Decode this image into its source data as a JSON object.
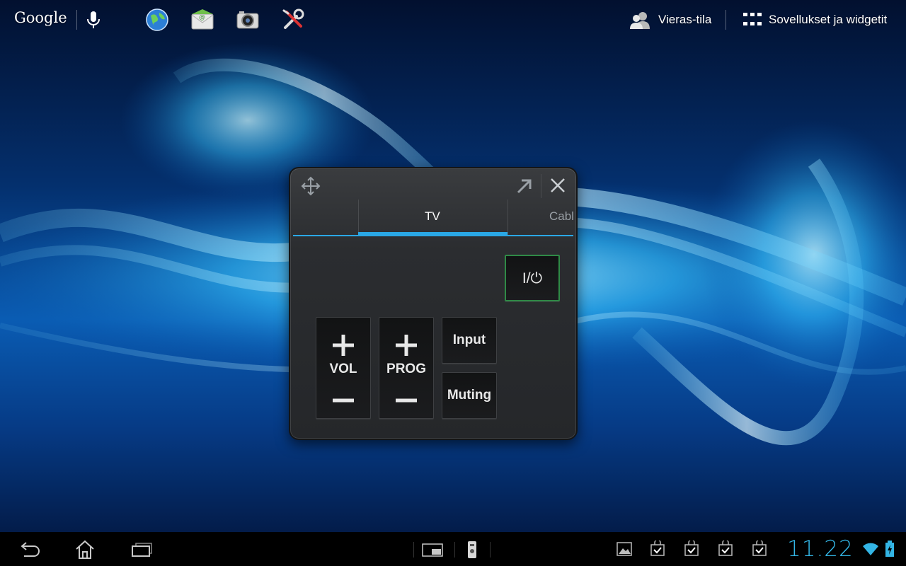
{
  "top_bar": {
    "search_label": "Google",
    "guest_mode_label": "Vieras-tila",
    "apps_label": "Sovellukset ja widgetit",
    "shortcuts": [
      "browser-icon",
      "email-icon",
      "camera-icon",
      "settings-tools-icon"
    ]
  },
  "widget": {
    "tabs": [
      {
        "label": "TV",
        "active": true
      },
      {
        "label": "Cabl",
        "active": false
      }
    ],
    "power_label": "I/⏻",
    "vol_label": "VOL",
    "prog_label": "PROG",
    "input_label": "Input",
    "muting_label": "Muting"
  },
  "nav_bar": {
    "time": "11.22",
    "notifications": [
      "gallery-icon",
      "market-bag-icon",
      "market-bag-icon",
      "market-bag-icon",
      "market-bag-icon"
    ]
  },
  "colors": {
    "accent": "#33b5e5",
    "tab_underline": "#2aa8e6",
    "power_border": "#2f8a46"
  }
}
